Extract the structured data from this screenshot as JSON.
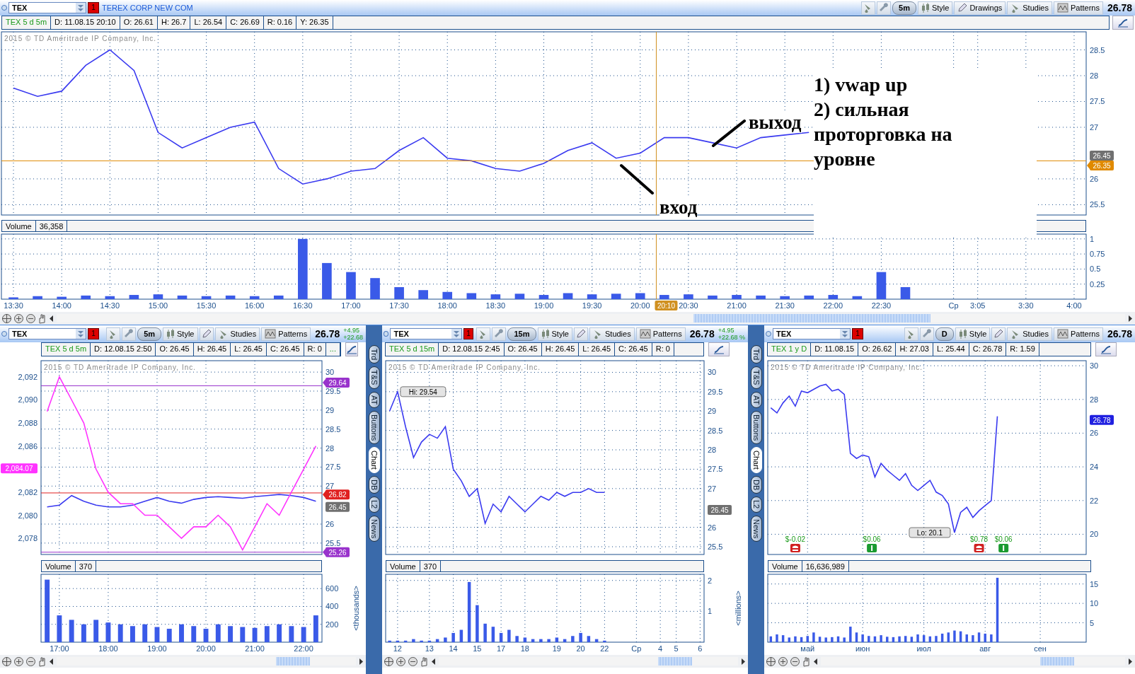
{
  "main": {
    "symbol": "TEX",
    "badge": "1",
    "company": "TEREX CORP NEW COM",
    "tools": [
      {
        "kind": "interval",
        "label": "5m"
      },
      {
        "kind": "style",
        "label": "Style"
      },
      {
        "kind": "drawings",
        "label": "Drawings"
      },
      {
        "kind": "studies",
        "label": "Studies"
      },
      {
        "kind": "patterns",
        "label": "Patterns"
      }
    ],
    "price": "26.78",
    "info": [
      "TEX 5 d 5m",
      "D: 11.08.15 20:10",
      "O: 26.61",
      "H: 26.7",
      "L: 26.54",
      "C: 26.69",
      "R: 0.16",
      "Y: 26.35"
    ],
    "watermark": "2015 © TD Ameritrade IP Company, Inc.",
    "chart_data": {
      "type": "line",
      "categories": [
        null,
        null,
        null,
        null,
        null,
        null,
        null,
        null,
        null,
        null,
        null,
        null,
        null,
        null,
        null,
        null,
        null,
        null,
        null,
        null,
        null,
        null,
        null,
        null,
        null,
        null,
        null,
        null,
        null,
        null,
        null,
        null,
        null,
        null,
        null,
        null,
        null,
        null,
        null,
        null,
        null,
        null,
        null,
        null,
        null
      ],
      "series": [
        {
          "color": "#3a3af0",
          "values": [
            27.76,
            27.6,
            27.7,
            28.2,
            28.5,
            28.1,
            26.9,
            26.6,
            26.8,
            27.0,
            27.1,
            26.2,
            25.9,
            26.0,
            26.15,
            26.2,
            26.55,
            26.8,
            26.4,
            26.35,
            26.2,
            26.15,
            26.3,
            26.55,
            26.7,
            26.4,
            26.5,
            26.8,
            26.8,
            26.7,
            26.6,
            26.8,
            26.85,
            26.9,
            null,
            null,
            null,
            null,
            null,
            null,
            null,
            null,
            null,
            null,
            null
          ]
        }
      ],
      "ylim": [
        25.3,
        28.85
      ],
      "yticks": [
        25.5,
        26,
        27,
        27.5,
        28,
        28.5
      ],
      "grid": true
    },
    "price_tags": [
      {
        "label": "26.45",
        "color": "#707070",
        "line": false
      },
      {
        "label": "26.35",
        "color": "#e08a00",
        "line": true
      }
    ],
    "cursor": {
      "label": "20:10",
      "color": "#d09020"
    },
    "volume": {
      "value": "36,358",
      "chart_data": {
        "type": "bar",
        "categories": [
          "13:30",
          null,
          "14:00",
          null,
          "14:30",
          null,
          "15:00",
          null,
          "15:30",
          null,
          "16:00",
          null,
          "16:30",
          null,
          "17:00",
          null,
          "17:30",
          null,
          "18:00",
          null,
          "18:30",
          null,
          "19:00",
          null,
          "19:30",
          null,
          "20:00",
          null,
          "20:30",
          null,
          "21:00",
          null,
          "21:30",
          null,
          "22:00",
          null,
          "22:30",
          null,
          null,
          "Ср",
          "3:05",
          null,
          "3:30",
          null,
          "4:00"
        ],
        "series": [
          {
            "name": "Volume",
            "color": "#3a5ae8",
            "values": [
              0.03,
              0.05,
              0.04,
              0.06,
              0.05,
              0.07,
              0.08,
              0.06,
              0.05,
              0.06,
              0.05,
              0.06,
              1.0,
              0.6,
              0.45,
              0.35,
              0.2,
              0.15,
              0.12,
              0.1,
              0.08,
              0.09,
              0.07,
              0.1,
              0.08,
              0.09,
              0.1,
              0.07,
              0.08,
              0.06,
              0.07,
              0.06,
              0.05,
              0.06,
              0.07,
              0.05,
              0.45,
              0.2,
              null,
              null,
              null,
              null,
              null,
              null,
              null
            ]
          }
        ],
        "ylim": [
          0,
          1.08
        ],
        "yticks": [
          0.25,
          0.5,
          0.75,
          1
        ],
        "grid": true
      }
    },
    "notes": {
      "lines": [
        "1) vwap up",
        "2) сильная",
        "проторговка на",
        "уровне"
      ],
      "entry": "вход",
      "exit": "выход"
    }
  },
  "panels": [
    {
      "symbol": "TEX",
      "badge": "1",
      "tools": [
        {
          "kind": "interval",
          "label": "5m"
        },
        {
          "kind": "style",
          "label": "Style"
        },
        {
          "kind": "drawings"
        },
        {
          "kind": "studies",
          "label": "Studies"
        },
        {
          "kind": "patterns",
          "label": "Patterns"
        }
      ],
      "price": "26.78",
      "change": [
        "+4.95",
        "+22.68"
      ],
      "info": [
        "TEX 5 d 5m",
        "D: 12.08.15 2:50",
        "O: 26.45",
        "H: 26.45",
        "L: 26.45",
        "C: 26.45",
        "R: 0",
        "..."
      ],
      "watermark": "2015 © TD Ameritrade IP Company, Inc.",
      "chart_data": {
        "type": "line",
        "categories": [
          null,
          null,
          null,
          null,
          null,
          null,
          null,
          null,
          null,
          null,
          null,
          null,
          null,
          null,
          null,
          null,
          null,
          null,
          null,
          null,
          null,
          null,
          null
        ],
        "series": [
          {
            "color": "#3a3af0",
            "values": [
              26.45,
              26.5,
              26.75,
              26.6,
              26.5,
              26.45,
              26.45,
              26.5,
              26.6,
              26.7,
              26.6,
              26.55,
              26.65,
              26.7,
              26.72,
              26.7,
              26.68,
              26.72,
              26.75,
              26.78,
              26.75,
              26.7,
              26.6
            ]
          }
        ],
        "ylim": [
          25.2,
          30.3
        ],
        "yticks": [
          25.5,
          26,
          27,
          27.5,
          28,
          28.5,
          29,
          29.5,
          30
        ],
        "grid": true
      },
      "price_tags": [
        {
          "label": "29.64",
          "color": "#9933cc",
          "line": true
        },
        {
          "label": "26.82",
          "color": "#e02020",
          "line": true
        },
        {
          "label": "26.45",
          "color": "#707070",
          "line": false
        },
        {
          "label": "25.26",
          "color": "#9933cc",
          "line": true
        }
      ],
      "index_chart": {
        "chart_data": {
          "type": "line",
          "categories": [
            null,
            null,
            null,
            null,
            null,
            null,
            null,
            null,
            null,
            null,
            null,
            null,
            null,
            null,
            null,
            null,
            null,
            null,
            null,
            null,
            null,
            null,
            null
          ],
          "series": [
            {
              "color": "#ff33ff",
              "values": [
                2089,
                2092,
                2090,
                2088,
                2084,
                2082,
                2081,
                2081,
                2080,
                2080,
                2079,
                2078,
                2079,
                2079,
                2080,
                2079,
                2077,
                2079,
                2081,
                2080,
                2082,
                2084,
                2086
              ]
            }
          ],
          "ylim": [
            2076.6,
            2093.4
          ],
          "yticks": [
            {
              "value": 2078,
              "label": "2,078"
            },
            {
              "value": 2080,
              "label": "2,080"
            },
            {
              "value": 2082,
              "label": "2,082"
            },
            {
              "value": 2086,
              "label": "2,086"
            },
            {
              "value": 2088,
              "label": "2,088"
            },
            {
              "value": 2090,
              "label": "2,090"
            },
            {
              "value": 2092,
              "label": "2,092"
            }
          ]
        },
        "price_tags": [
          {
            "label": "2,084.07",
            "color": "#ff33ff",
            "line": false
          }
        ]
      },
      "volume": {
        "value": "370",
        "chart_data": {
          "type": "bar",
          "categories": [
            null,
            "17:00",
            null,
            null,
            null,
            "18:00",
            null,
            null,
            null,
            "19:00",
            null,
            null,
            null,
            "20:00",
            null,
            null,
            null,
            "21:00",
            null,
            null,
            null,
            "22:00",
            null
          ],
          "series": [
            {
              "name": "Volume",
              "color": "#3a5ae8",
              "values": [
                700,
                300,
                250,
                200,
                250,
                220,
                200,
                180,
                200,
                170,
                150,
                200,
                180,
                150,
                200,
                180,
                170,
                160,
                180,
                200,
                180,
                170,
                300
              ]
            }
          ],
          "ylim": [
            0,
            760
          ],
          "yticks": [
            200,
            400,
            600
          ],
          "ylabel": "<thousands>",
          "grid": true
        }
      }
    },
    {
      "symbol": "TEX",
      "badge": "1",
      "tools": [
        {
          "kind": "interval",
          "label": "15m"
        },
        {
          "kind": "style",
          "label": "Style"
        },
        {
          "kind": "drawings"
        },
        {
          "kind": "studies",
          "label": "Studies"
        },
        {
          "kind": "patterns",
          "label": "Patterns"
        }
      ],
      "price": "26.78",
      "change": [
        "+4.95",
        "+22.68 %"
      ],
      "info": [
        "TEX 5 d 15m",
        "D: 12.08.15 2:45",
        "O: 26.45",
        "H: 26.45",
        "L: 26.45",
        "C: 26.45",
        "R: 0"
      ],
      "watermark": "2015 © TD Ameritrade IP Company, Inc.",
      "chart_data": {
        "type": "line",
        "categories": [
          null,
          null,
          null,
          null,
          null,
          null,
          null,
          null,
          null,
          null,
          null,
          null,
          null,
          null,
          null,
          null,
          null,
          null,
          null,
          null,
          null,
          null,
          null,
          null,
          null,
          null,
          null,
          null,
          null,
          null,
          null,
          null,
          null,
          null,
          null,
          null,
          null,
          null,
          null,
          null
        ],
        "series": [
          {
            "color": "#3a3af0",
            "values": [
              29.0,
              29.5,
              28.6,
              27.8,
              28.2,
              28.4,
              28.3,
              28.6,
              27.5,
              27.2,
              26.8,
              27.0,
              26.1,
              26.6,
              26.4,
              26.8,
              26.6,
              26.4,
              26.6,
              26.8,
              26.7,
              26.9,
              26.8,
              26.9,
              26.9,
              27.0,
              26.9,
              26.9,
              null,
              null,
              null,
              null,
              null,
              null,
              null,
              null,
              null,
              null,
              null,
              null
            ]
          }
        ],
        "ylim": [
          25.3,
          30.3
        ],
        "yticks": [
          25.5,
          26,
          27,
          27.5,
          28,
          28.5,
          29,
          29.5,
          30
        ],
        "grid": true
      },
      "high_label": "Hi: 29.54",
      "price_tags": [
        {
          "label": "26.45",
          "color": "#707070",
          "line": false
        }
      ],
      "volume": {
        "value": "370",
        "chart_data": {
          "type": "bar",
          "categories": [
            null,
            "12",
            null,
            null,
            null,
            "13",
            null,
            null,
            "14",
            null,
            null,
            "15",
            null,
            null,
            "17",
            null,
            null,
            "18",
            null,
            null,
            null,
            "19",
            null,
            null,
            "20",
            null,
            null,
            "22",
            null,
            null,
            null,
            "Ср",
            null,
            null,
            "4",
            null,
            "5",
            null,
            null,
            "6"
          ],
          "series": [
            {
              "name": "Volume",
              "color": "#3a5ae8",
              "values": [
                0.05,
                0.05,
                0.05,
                0.1,
                0.05,
                0.05,
                0.1,
                0.15,
                0.3,
                0.4,
                1.95,
                1.2,
                0.6,
                0.5,
                0.3,
                0.4,
                0.2,
                0.15,
                0.1,
                0.1,
                0.1,
                0.15,
                0.1,
                0.2,
                0.3,
                0.2,
                0.1,
                0.05,
                null,
                null,
                null,
                null,
                null,
                null,
                null,
                null,
                null,
                null,
                null,
                null
              ]
            }
          ],
          "ylim": [
            0,
            2.2
          ],
          "yticks": [
            1,
            2
          ],
          "ylabel": "<millions>",
          "grid": true
        }
      }
    },
    {
      "symbol": "TEX",
      "badge": "1",
      "tools": [
        {
          "kind": "interval",
          "label": "D"
        },
        {
          "kind": "style",
          "label": "Style"
        },
        {
          "kind": "drawings"
        },
        {
          "kind": "studies",
          "label": "Studies"
        },
        {
          "kind": "patterns",
          "label": "Patterns"
        }
      ],
      "price": "26.78",
      "info": [
        "TEX 1 y D",
        "D: 11.08.15",
        "O: 26.62",
        "H: 27.03",
        "L: 25.44",
        "C: 26.78",
        "R: 1.59"
      ],
      "watermark": "2015 © TD Ameritrade IP Company, Inc.",
      "chart_data": {
        "type": "line",
        "categories": [
          null,
          null,
          null,
          null,
          null,
          null,
          null,
          null,
          null,
          null,
          null,
          null,
          null,
          null,
          null,
          null,
          null,
          null,
          null,
          null,
          null,
          null,
          null,
          null,
          null,
          null,
          null,
          null,
          null,
          null,
          null,
          null,
          null,
          null,
          null,
          null,
          null,
          null,
          null,
          null,
          null,
          null,
          null,
          null,
          null,
          null,
          null,
          null,
          null,
          null,
          null,
          null
        ],
        "series": [
          {
            "color": "#3a3af0",
            "values": [
              27.5,
              27.2,
              27.8,
              28.2,
              27.6,
              28.5,
              28.4,
              28.6,
              28.8,
              28.9,
              28.5,
              28.6,
              28.3,
              24.8,
              24.5,
              24.7,
              24.6,
              23.4,
              24.2,
              23.8,
              23.5,
              23.2,
              23.6,
              22.9,
              22.6,
              22.9,
              23.2,
              22.5,
              22.3,
              21.8,
              20.1,
              21.3,
              21.6,
              21.0,
              21.4,
              21.7,
              22.0,
              27.0,
              null,
              null,
              null,
              null,
              null,
              null,
              null,
              null,
              null,
              null,
              null,
              null,
              null,
              null
            ]
          }
        ],
        "ylim": [
          18.8,
          30.3
        ],
        "yticks": [
          20,
          22,
          24,
          26,
          28,
          30
        ],
        "grid": true
      },
      "price_tags": [
        {
          "label": "26.78",
          "color": "#2020e0",
          "line": false
        }
      ],
      "low_label": "Lo: 20.1",
      "events": [
        {
          "label": "$-0.02",
          "kind": "phone"
        },
        {
          "label": "$0.06",
          "kind": "dollar"
        },
        {
          "label": "$0.78",
          "kind": "phone"
        },
        {
          "label": "$0.06",
          "kind": "dollar"
        }
      ],
      "volume": {
        "value": "16,636,989",
        "chart_data": {
          "type": "bar",
          "categories": [
            null,
            null,
            null,
            null,
            null,
            null,
            "май",
            null,
            null,
            null,
            null,
            null,
            null,
            null,
            null,
            "июн",
            null,
            null,
            null,
            null,
            null,
            null,
            null,
            null,
            null,
            "июл",
            null,
            null,
            null,
            null,
            null,
            null,
            null,
            null,
            null,
            "авг",
            null,
            null,
            null,
            null,
            null,
            null,
            null,
            null,
            "сен",
            null,
            null,
            null,
            null,
            null,
            null,
            null
          ],
          "series": [
            {
              "name": "Volume",
              "color": "#3a5ae8",
              "values": [
                1.5,
                2,
                1.8,
                1.2,
                1.5,
                1.3,
                1.6,
                2.5,
                1.4,
                1.2,
                1.3,
                1.5,
                1.2,
                4,
                2.5,
                2,
                1.6,
                1.5,
                1.8,
                1.4,
                1.3,
                1.5,
                1.6,
                1.4,
                2,
                1.8,
                1.5,
                1.6,
                2.2,
                2.5,
                3,
                2.8,
                2,
                1.8,
                2.5,
                2.2,
                2,
                16.6,
                null,
                null,
                null,
                null,
                null,
                null,
                null,
                null,
                null,
                null,
                null,
                null,
                null,
                null
              ]
            }
          ],
          "ylim": [
            0,
            17.5
          ],
          "yticks": [
            5,
            10,
            15
          ],
          "grid": true
        }
      }
    }
  ],
  "strips": [
    {
      "tabs": [
        {
          "label": "Trd",
          "selected": false
        },
        {
          "label": "T&S",
          "selected": false
        },
        {
          "label": "AT",
          "selected": false
        },
        {
          "label": "Buttons",
          "selected": false
        },
        {
          "label": "Chart",
          "selected": true
        },
        {
          "label": "DB",
          "selected": false
        },
        {
          "label": "L2",
          "selected": false
        },
        {
          "label": "News",
          "selected": false
        }
      ]
    },
    {
      "tabs": [
        {
          "label": "Trd",
          "selected": false
        },
        {
          "label": "T&S",
          "selected": false
        },
        {
          "label": "AT",
          "selected": false
        },
        {
          "label": "Buttons",
          "selected": false
        },
        {
          "label": "Chart",
          "selected": true
        },
        {
          "label": "DB",
          "selected": false
        },
        {
          "label": "L2",
          "selected": false
        },
        {
          "label": "News",
          "selected": false
        }
      ]
    }
  ]
}
